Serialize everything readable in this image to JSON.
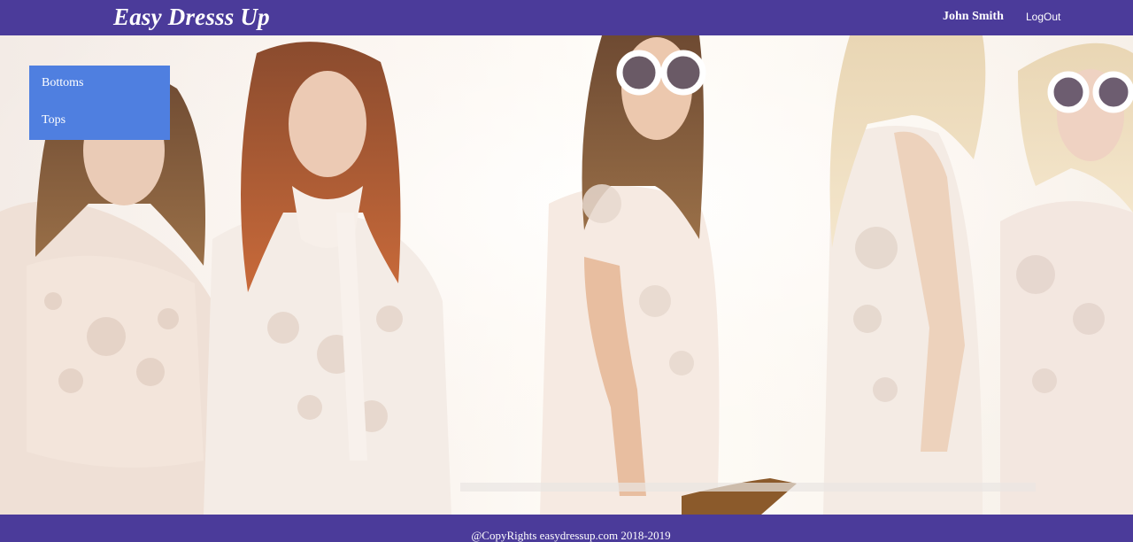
{
  "header": {
    "brand": "Easy Dresss Up",
    "user_name": "John Smith",
    "logout_label": "LogOut"
  },
  "side_menu": {
    "items": [
      {
        "label": "Bottoms"
      },
      {
        "label": "Tops"
      }
    ]
  },
  "hero": {
    "icon": "fashion-models-photo"
  },
  "footer": {
    "text": "@CopyRights easydressup.com 2018-2019"
  },
  "colors": {
    "navbar": "#4b3b9a",
    "side_menu": "#4f7fe0",
    "text": "#ffffff"
  }
}
